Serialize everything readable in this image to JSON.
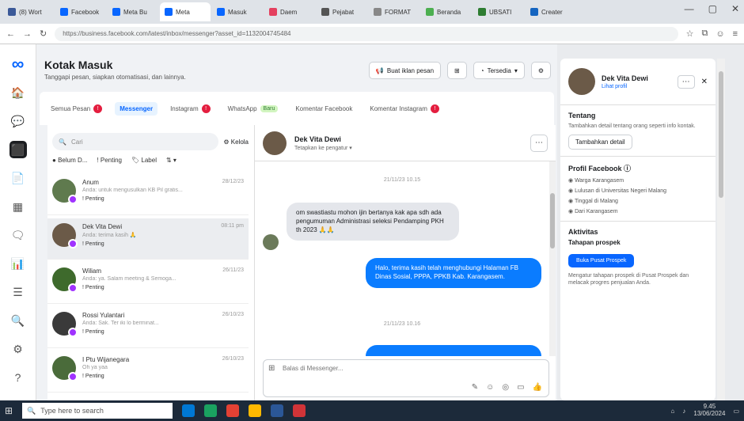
{
  "browser": {
    "tabs": [
      {
        "label": "(8) Wort",
        "color": "#3b5998"
      },
      {
        "label": "Facebook",
        "color": "#0866ff"
      },
      {
        "label": "Meta Bu",
        "color": "#0866ff"
      },
      {
        "label": "Meta",
        "color": "#0866ff",
        "active": true
      },
      {
        "label": "Masuk",
        "color": "#0866ff"
      },
      {
        "label": "Daem",
        "color": "#e4405f"
      },
      {
        "label": "Pejabat",
        "color": "#555"
      },
      {
        "label": "FORMAT",
        "color": "#888"
      },
      {
        "label": "Beranda",
        "color": "#4caf50"
      },
      {
        "label": "UBSATI",
        "color": "#2e7d32"
      },
      {
        "label": "Creater",
        "color": "#1565c0"
      }
    ],
    "url": "https://business.facebook.com/latest/inbox/messenger?asset_id=1132004745484",
    "win_controls": [
      "—",
      "▢",
      "✕"
    ]
  },
  "rail": {
    "logo": "∞",
    "icons": [
      "🏠",
      "💬",
      "⬛",
      "📄",
      "▦",
      "🗨",
      "📊",
      "☰",
      "🔍",
      "⚙",
      "?"
    ]
  },
  "header": {
    "title": "Kotak Masuk",
    "subtitle": "Tanggapi pesan, siapkan otomatisasi, dan lainnya.",
    "btn_post": "Buat iklan pesan",
    "btn_status": "Tersedia",
    "qr": "⊞",
    "gear": "⚙"
  },
  "tabs": [
    {
      "label": "Semua Pesan",
      "badge": "!"
    },
    {
      "label": "Messenger",
      "active": true
    },
    {
      "label": "Instagram",
      "badge": "!"
    },
    {
      "label": "WhatsApp",
      "new": "Baru"
    },
    {
      "label": "Komentar Facebook"
    },
    {
      "label": "Komentar Instagram",
      "badge": "!"
    }
  ],
  "inbox": {
    "search_placeholder": "Cari",
    "kelola": "Kelola",
    "filter_unread": "Belum D...",
    "filter_pending": "Penting",
    "filter_label": "Label",
    "conversations": [
      {
        "name": "Anum",
        "snippet": "Anda: untuk mengusulkan KB Pil gratis...",
        "time": "28/12/23",
        "tag": "Penting",
        "avatar": "#5f7a4e"
      },
      {
        "name": "Dek Vita Dewi",
        "snippet": "Anda: terima kasih 🙏",
        "time": "08:11 pm",
        "tag": "Penting",
        "avatar": "#6b5a48",
        "selected": true
      },
      {
        "name": "Wiliam",
        "snippet": "Anda: ya. Salam meeting & Semoga...",
        "time": "26/11/23",
        "tag": "Penting",
        "avatar": "#3e6a2c"
      },
      {
        "name": "Rossi Yulantari",
        "snippet": "Anda: Sak. Ter iki lo berminat...",
        "time": "26/10/23",
        "tag": "Penting",
        "avatar": "#3a3a3a"
      },
      {
        "name": "I Ptu Wijanegara",
        "snippet": "Oh ya yaa",
        "time": "26/10/23",
        "tag": "Penting",
        "avatar": "#4a6b3a"
      }
    ]
  },
  "chat": {
    "name": "Dek Vita Dewi",
    "sub": "Tetapkan ke pengatur",
    "stamp1": "21/11/23 10.15",
    "msg_in": "om swastiastu mohon ijin bertanya kak apa sdh ada pengumuman Administrasi seleksi Pendamping PKH th 2023 🙏🙏",
    "msg_out": "Halo, terima kasih telah menghubungi Halaman FB Dinas Sosial, PPPA, PPKB Kab. Karangasem.",
    "stamp2": "21/11/23 10.16",
    "composer_placeholder": "Balas di Messenger..."
  },
  "right": {
    "name": "Dek Vita Dewi",
    "link": "Lihat profil",
    "about_title": "Tentang",
    "about_text": "Tambahkan detail tentang orang seperti info kontak.",
    "about_btn": "Tambahkan detail",
    "fb_title": "Profil Facebook ⓘ",
    "fb_items": [
      "Warga Karangasem",
      "Lulusan di Universitas Negeri Malang",
      "Tinggal di Malang",
      "Dari Karangasem"
    ],
    "act_title": "Aktivitas",
    "act_sub": "Tahapan prospek",
    "act_btn": "Buka Pusat Prospek",
    "act_text": "Mengatur tahapan prospek di Pusat Prospek dan melacak progres penjualan Anda."
  },
  "taskbar": {
    "search": "Type here to search",
    "time": "9.45",
    "date": "13/06/2024",
    "apps": [
      "#0078d4",
      "#1aa260",
      "#e44134",
      "#ffb900",
      "#2b5797",
      "#d13438"
    ]
  }
}
